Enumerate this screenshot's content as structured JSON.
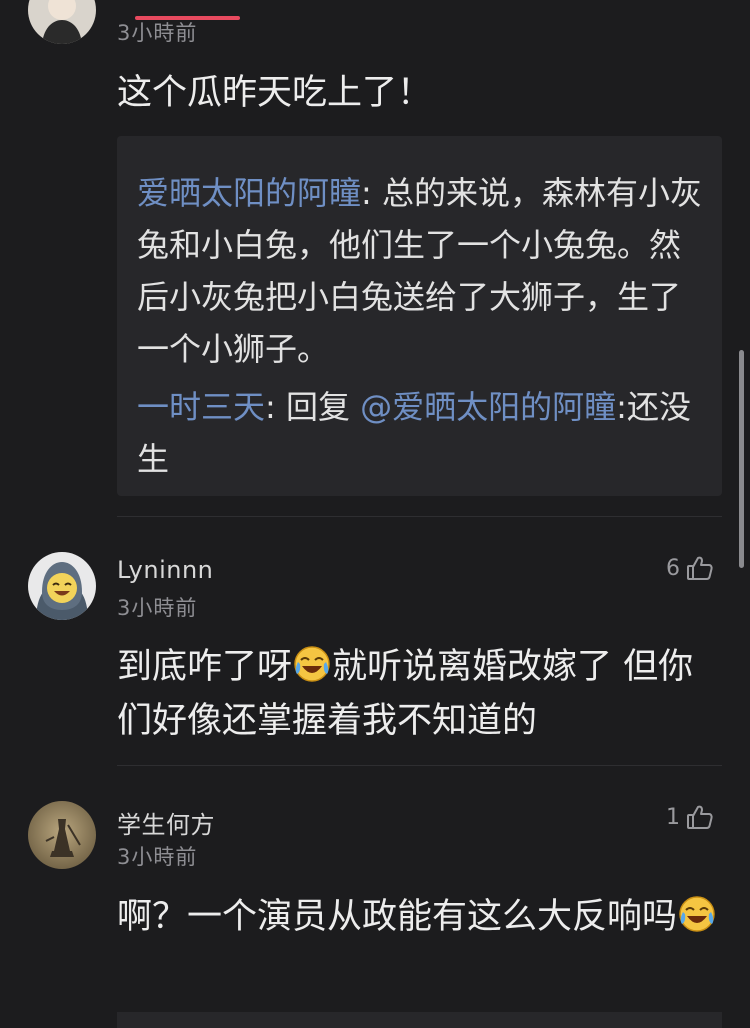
{
  "comments": [
    {
      "time": "3小時前",
      "text": "这个瓜昨天吃上了！",
      "replies": [
        {
          "author": "爱晒太阳的阿瞳",
          "sep": ": ",
          "text": "总的来说，森林有小灰兔和小白兔，他们生了一个小兔兔。然后小灰兔把小白兔送给了大狮子，生了一个小狮子。"
        },
        {
          "author": "一时三天",
          "sep": ": ",
          "reply_prefix": "回复 ",
          "mention": "@爱晒太阳的阿瞳",
          "sep2": ":",
          "text": "还没生"
        }
      ]
    },
    {
      "username": "Lyninnn",
      "time": "3小時前",
      "likes": "6",
      "text_part1": "到底咋了呀",
      "text_part2": "就听说离婚改嫁了 但你们好像还掌握着我不知道的"
    },
    {
      "username": "学生何方",
      "time": "3小時前",
      "likes": "1",
      "text_part1": "啊？一个演员从政能有这么大反响吗"
    }
  ],
  "icons": {
    "like": "thumbs-up-outline-icon",
    "emoji": "laughing-crying-emoji"
  },
  "colors": {
    "background": "#1c1c1e",
    "reply_box": "#27272a",
    "author_link": "#6f8fc4",
    "accent": "#e84a5f"
  }
}
